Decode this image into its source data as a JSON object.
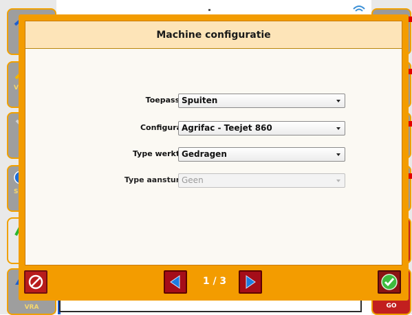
{
  "background": {
    "left_buttons": [
      {
        "icon": "arrow-icon",
        "label": ""
      },
      {
        "icon": "wrench-icon",
        "label": "V"
      },
      {
        "icon": "tool-icon",
        "label": ""
      },
      {
        "icon": "info-icon",
        "label": "S"
      },
      {
        "icon": "field-icon",
        "label": ""
      },
      {
        "icon": "triangle-icon",
        "label": "VRA"
      }
    ],
    "right_buttons": [
      {
        "label": ""
      },
      {
        "label": ""
      },
      {
        "label": ""
      },
      {
        "label": ""
      },
      {
        "label": ""
      },
      {
        "label": "GO"
      }
    ]
  },
  "dialog": {
    "title": "Machine configuratie",
    "fields": [
      {
        "label": "Toepassing:",
        "value": "Spuiten",
        "disabled": false
      },
      {
        "label": "Configuratie:",
        "value": "Agrifac - Teejet 860",
        "disabled": false
      },
      {
        "label": "Type werktuig:",
        "value": "Gedragen",
        "disabled": false
      },
      {
        "label": "Type aansturing:",
        "value": "Geen",
        "disabled": true
      }
    ],
    "footer": {
      "page_indicator": "1 / 3"
    }
  },
  "colors": {
    "dialog_frame": "#f39c00",
    "header_bg": "#fde4b8",
    "button_red": "#a50d19",
    "arrow_blue": "#1e7be0",
    "ok_green": "#3dbb3d"
  }
}
